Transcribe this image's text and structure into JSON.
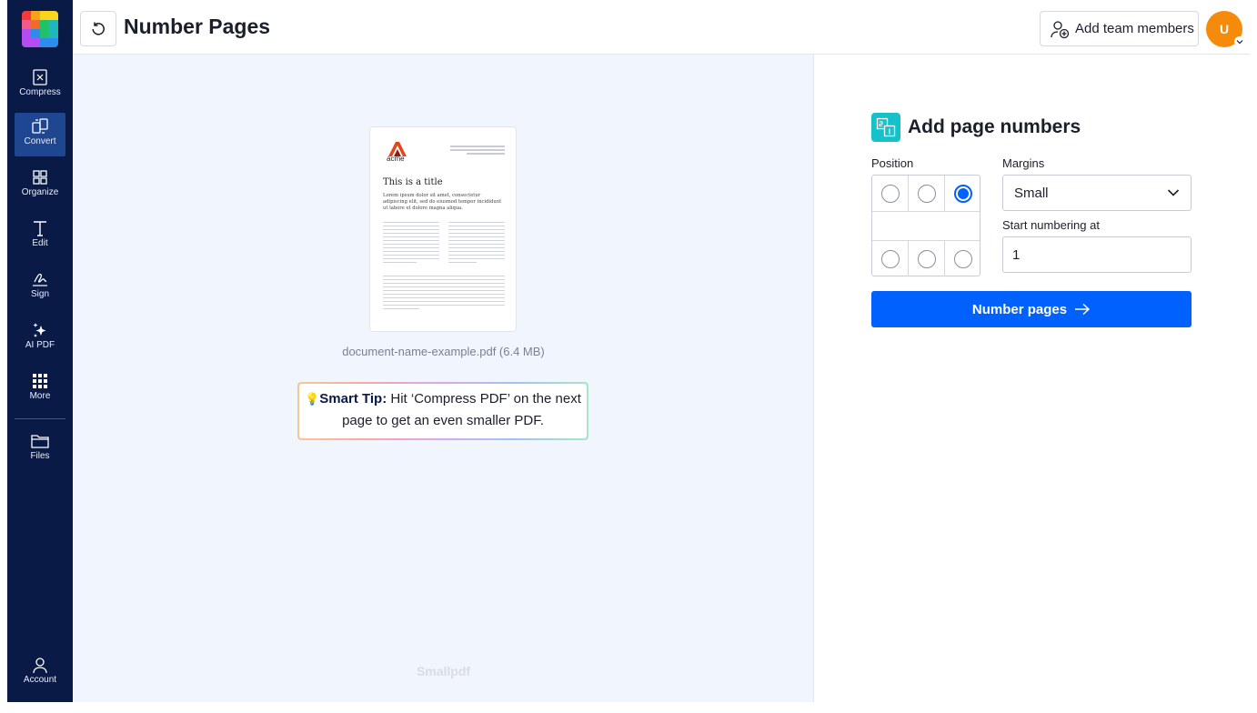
{
  "app": {
    "title": "Number Pages",
    "brand_watermark": "Smallpdf"
  },
  "sidebar": {
    "items": [
      {
        "label": "Compress",
        "icon": "compress-icon"
      },
      {
        "label": "Convert",
        "icon": "convert-icon",
        "active": true
      },
      {
        "label": "Organize",
        "icon": "organize-icon"
      },
      {
        "label": "Edit",
        "icon": "edit-icon"
      },
      {
        "label": "Sign",
        "icon": "sign-icon"
      },
      {
        "label": "AI PDF",
        "icon": "sparkle-icon"
      },
      {
        "label": "More",
        "icon": "grid-icon"
      },
      {
        "label": "Files",
        "icon": "folder-icon"
      }
    ],
    "account_label": "Account"
  },
  "header": {
    "add_team_label": "Add team members",
    "avatar_initial": "U"
  },
  "preview": {
    "filename": "document-name-example.pdf (6.4 MB)",
    "thumb_brand": "acme",
    "thumb_title": "This is a title",
    "thumb_lead": "Lorem ipsum dolor sit amet, consectetur adipiscing elit, sed do eiusmod tempor incididunt ut labore et dolore magna aliqua."
  },
  "tip": {
    "bold": "Smart Tip:",
    "text": " Hit ‘Compress PDF’ on the next page to get an even smaller PDF."
  },
  "panel": {
    "title": "Add page numbers",
    "position_label": "Position",
    "margins_label": "Margins",
    "margins_value": "Small",
    "start_label": "Start numbering at",
    "start_value": "1",
    "submit_label": "Number pages",
    "selected_position": "top-right"
  },
  "colors": {
    "sidebar_bg": "#0a1a47",
    "accent": "#0061fe",
    "avatar": "#f68a0a",
    "main_bg": "#f1f5fd"
  }
}
